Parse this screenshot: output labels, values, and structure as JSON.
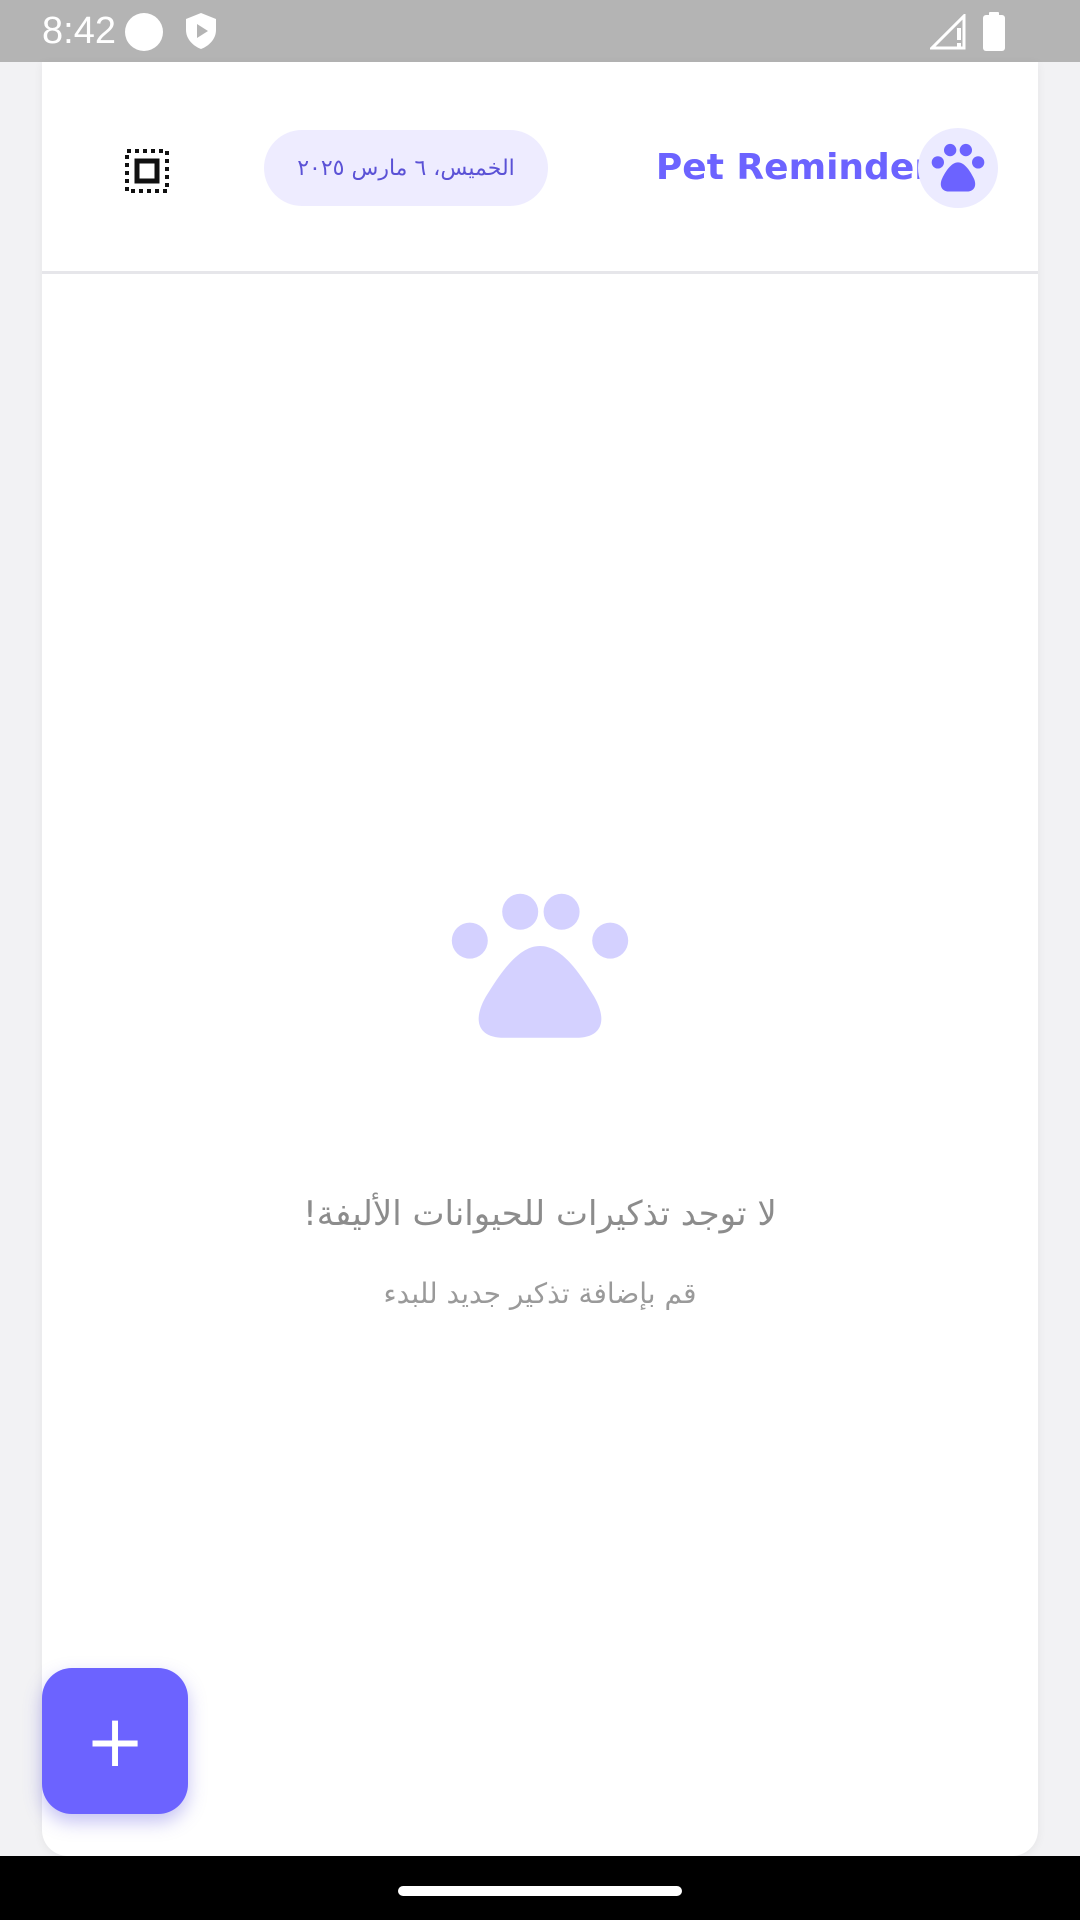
{
  "status_bar": {
    "time": "8:42",
    "icons": [
      "circle-icon",
      "shield-play-icon",
      "signal-off-icon",
      "battery-icon"
    ]
  },
  "header": {
    "title": "Pet Reminder",
    "date": "الخميس، ٦ مارس ٢٠٢٥",
    "logo_icon": "paw-icon",
    "menu_icon": "grid-select-icon"
  },
  "empty_state": {
    "icon": "paw-icon",
    "title": "لا توجد تذكيرات للحيوانات الأليفة!",
    "subtitle": "قم بإضافة تذكير جديد للبدء"
  },
  "fab": {
    "label": "+"
  },
  "colors": {
    "accent": "#6c63ff",
    "accent_light": "#d4d1ff",
    "chip_bg": "#eeecff",
    "muted_text": "#8c8c8c"
  }
}
